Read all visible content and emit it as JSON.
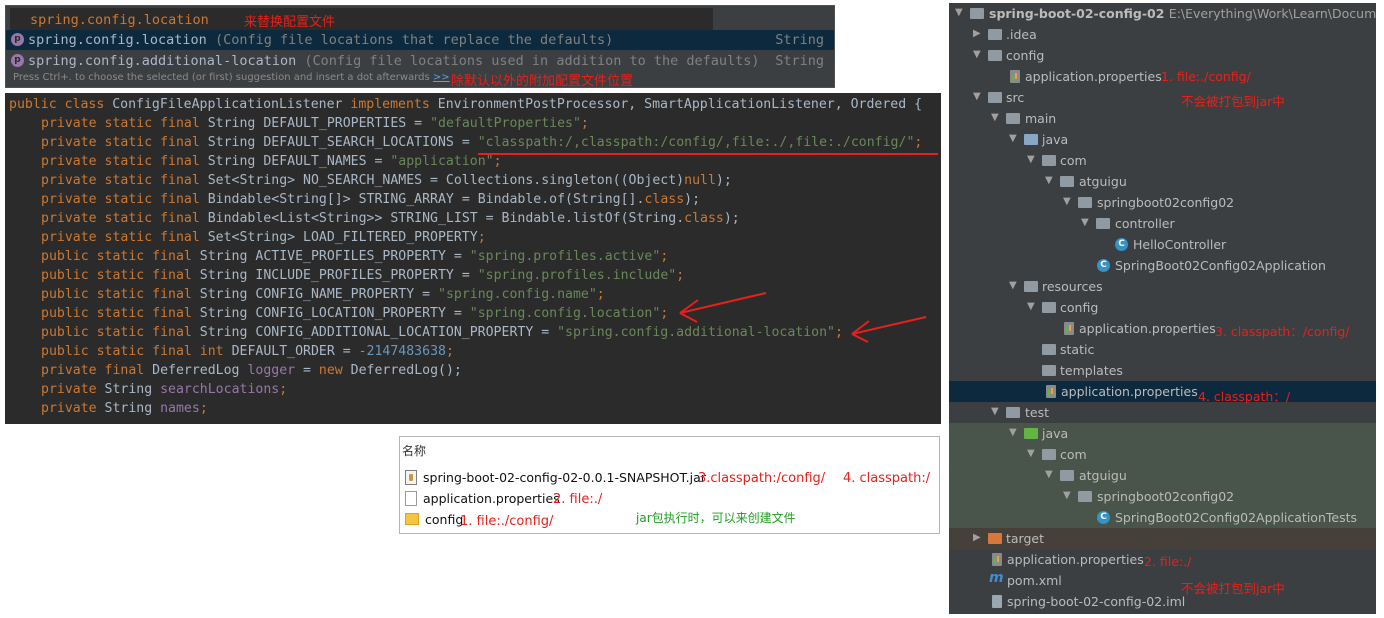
{
  "popup": {
    "typed_text": "spring.config.location",
    "typed_annotation": "来替换配置文件",
    "suggestions": [
      {
        "name": "spring.config.location",
        "desc": "(Config file locations that replace the defaults)",
        "type": "String"
      },
      {
        "name": "spring.config.additional-location",
        "desc": "(Config file locations used in addition to the defaults)",
        "type": "String"
      }
    ],
    "hint": "Press Ctrl+. to choose the selected (or first) suggestion and insert a dot afterwards",
    "hint_link": ">>",
    "hint_annotation": "除默认以外的附加配置文件位置"
  },
  "code": {
    "l1": {
      "a": "public class ",
      "b": "ConfigFileApplicationListener ",
      "c": "implements ",
      "d": "EnvironmentPostProcessor, SmartApplicationListener, Ordered {"
    },
    "l2": {
      "a": "private static final ",
      "b": "String ",
      "c": "DEFAULT_PROPERTIES",
      "d": " = ",
      "e": "\"defaultProperties\"",
      "f": ";"
    },
    "l3": {
      "a": "private static final ",
      "b": "String ",
      "c": "DEFAULT_SEARCH_LOCATIONS",
      "d": " = ",
      "e": "\"classpath:/,classpath:/config/,file:./,file:./config/\"",
      "f": ";"
    },
    "l4": {
      "a": "private static final ",
      "b": "String ",
      "c": "DEFAULT_NAMES",
      "d": " = ",
      "e": "\"application\"",
      "f": ";"
    },
    "l5": {
      "a": "private static final ",
      "b": "Set<String> ",
      "c": "NO_SEARCH_NAMES",
      "d": " = Collections.singleton((Object)",
      "e": "null",
      "f": ");"
    },
    "l6": {
      "a": "private static final ",
      "b": "Bindable<String[]> ",
      "c": "STRING_ARRAY",
      "d": " = Bindable.of(String[].",
      "e": "class",
      "f": ");"
    },
    "l7": {
      "a": "private static final ",
      "b": "Bindable<List<String>> ",
      "c": "STRING_LIST",
      "d": " = Bindable.listOf(String.",
      "e": "class",
      "f": ");"
    },
    "l8": {
      "a": "private static final ",
      "b": "Set<String> ",
      "c": "LOAD_FILTERED_PROPERTY",
      "f": ";"
    },
    "l9": {
      "a": "public static final ",
      "b": "String ",
      "c": "ACTIVE_PROFILES_PROPERTY",
      "d": " = ",
      "e": "\"spring.profiles.active\"",
      "f": ";"
    },
    "l10": {
      "a": "public static final ",
      "b": "String ",
      "c": "INCLUDE_PROFILES_PROPERTY",
      "d": " = ",
      "e": "\"spring.profiles.include\"",
      "f": ";"
    },
    "l11": {
      "a": "public static final ",
      "b": "String ",
      "c": "CONFIG_NAME_PROPERTY",
      "d": " = ",
      "e": "\"spring.config.name\"",
      "f": ";"
    },
    "l12": {
      "a": "public static final ",
      "b": "String ",
      "c": "CONFIG_LOCATION_PROPERTY",
      "d": " = ",
      "e": "\"spring.config.location\"",
      "f": ";"
    },
    "l13": {
      "a": "public static final ",
      "b": "String ",
      "c": "CONFIG_ADDITIONAL_LOCATION_PROPERTY",
      "d": " = ",
      "e": "\"spring.config.additional-location\"",
      "f": ";"
    },
    "l14": {
      "a": "public static final ",
      "b": "int ",
      "c": "DEFAULT_ORDER",
      "d": " = ",
      "e": "-2147483638",
      "f": ";"
    },
    "l15": {
      "a": "private final ",
      "b": "DeferredLog ",
      "c": "logger",
      "d": " = ",
      "e": "new ",
      "f": "DeferredLog();"
    },
    "l16": {
      "a": "private ",
      "b": "String ",
      "c": "searchLocations",
      "f": ";"
    },
    "l17": {
      "a": "private ",
      "b": "String ",
      "c": "names",
      "f": ";"
    }
  },
  "files": {
    "header": "名称",
    "items": [
      {
        "name": "spring-boot-02-config-02-0.0.1-SNAPSHOT.jar",
        "ann1": "3.classpath:/config/",
        "ann2": "4. classpath:/"
      },
      {
        "name": "application.properties",
        "ann1": "2. file:./"
      },
      {
        "name": "config",
        "ann1": "1. file:./config/"
      }
    ],
    "note": "jar包执行时，可以来创建文件"
  },
  "tree": {
    "root": "spring-boot-02-config-02",
    "root_path": "E:\\Everything\\Work\\Learn\\Document\\S",
    "idea": ".idea",
    "config": "config",
    "config_props": "application.properties",
    "config_ann": "1. file:./config/",
    "config_ann2": "不会被打包到jar中",
    "src": "src",
    "main": "main",
    "java": "java",
    "com": "com",
    "atguigu": "atguigu",
    "pkg": "springboot02config02",
    "controller": "controller",
    "hello": "HelloController",
    "app": "SpringBoot02Config02Application",
    "resources": "resources",
    "res_config": "config",
    "res_config_props": "application.properties",
    "res_config_ann": "3. classpath：/config/",
    "static": "static",
    "templates": "templates",
    "res_props": "application.properties",
    "res_props_ann": "4. classpath：/",
    "test": "test",
    "test_java": "java",
    "test_com": "com",
    "test_atguigu": "atguigu",
    "test_pkg": "springboot02config02",
    "tests_class": "SpringBoot02Config02ApplicationTests",
    "target": "target",
    "root_props": "application.properties",
    "root_props_ann": "2. file:./",
    "root_props_ann2": "不会被打包到jar中",
    "pom": "pom.xml",
    "iml": "spring-boot-02-config-02.iml"
  },
  "colors": {
    "accent_red": "#e8201a",
    "editor_bg": "#2b2b2b",
    "keyword": "#cc7832",
    "string": "#6a8759"
  }
}
